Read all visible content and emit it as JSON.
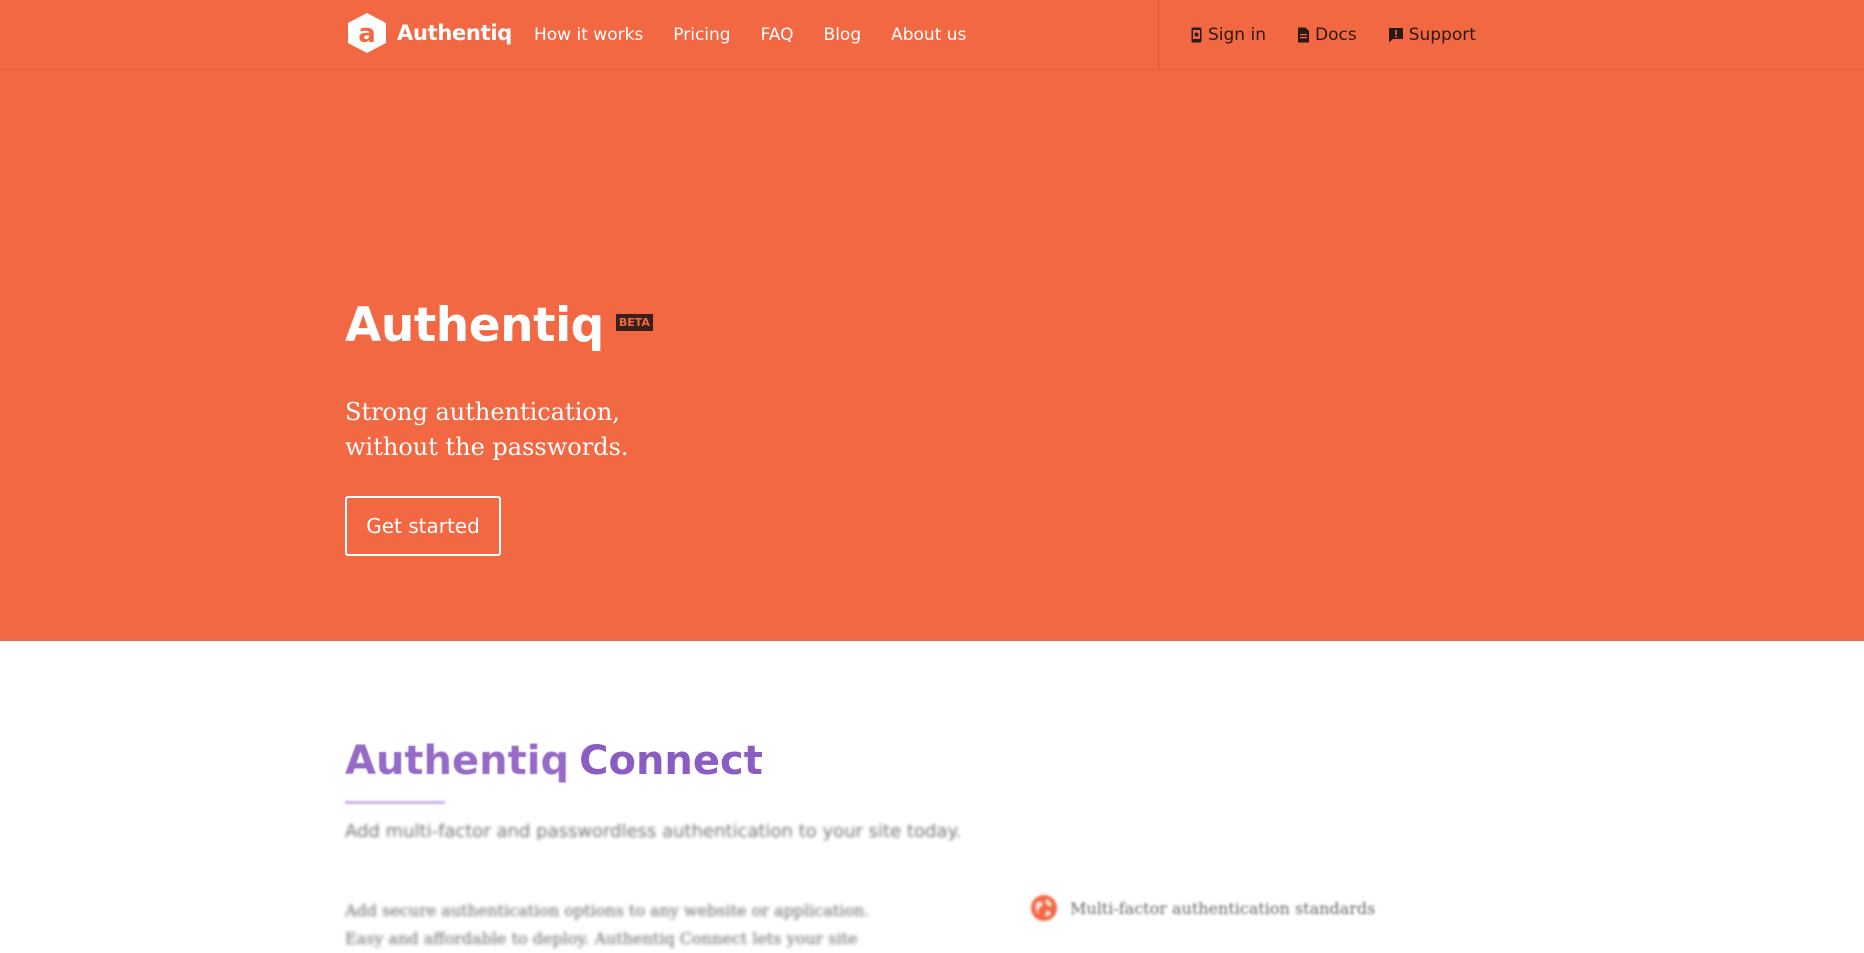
{
  "brand": {
    "name": "Authentiq",
    "logo_letter": "a",
    "primary_color": "#f26843",
    "accent_color": "#8b5cc1"
  },
  "nav": {
    "links": [
      {
        "label": "How it works"
      },
      {
        "label": "Pricing"
      },
      {
        "label": "FAQ"
      },
      {
        "label": "Blog"
      },
      {
        "label": "About us"
      }
    ],
    "right": [
      {
        "label": "Sign in",
        "icon": "phone-icon"
      },
      {
        "label": "Docs",
        "icon": "document-icon"
      },
      {
        "label": "Support",
        "icon": "support-chat-icon"
      }
    ]
  },
  "hero": {
    "title": "Authentiq",
    "badge": "BETA",
    "subtitle_line1": "Strong authentication,",
    "subtitle_line2": "without the passwords.",
    "cta_label": "Get started"
  },
  "connect": {
    "title_part1": "Authentiq",
    "title_part2": "Connect",
    "lead": "Add multi-factor and passwordless authentication to your site today.",
    "body_line1": "Add secure authentication options to any website or application.",
    "body_line2": "Easy and affordable to deploy. Authentiq Connect lets your site",
    "feature1": "Multi-factor authentication standards",
    "feature1_icon": "globe-icon"
  }
}
